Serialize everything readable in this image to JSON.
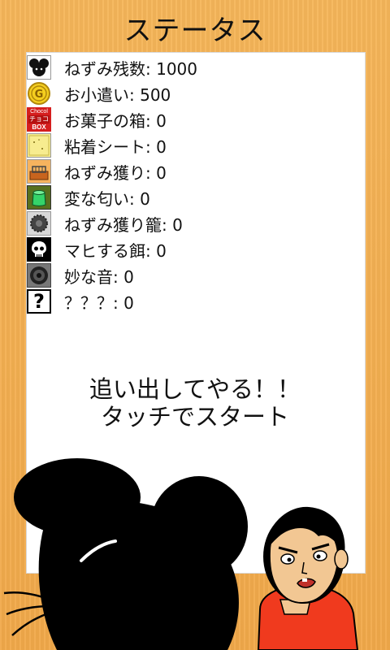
{
  "screen": {
    "title": "ステータス"
  },
  "status_items": [
    {
      "label": "ねずみ残数",
      "value": "1000",
      "icon": "mouse-face-icon"
    },
    {
      "label": "お小遣い",
      "value": "500",
      "icon": "gold-coin-icon"
    },
    {
      "label": "お菓子の箱",
      "value": "0",
      "icon": "choco-box-icon"
    },
    {
      "label": "粘着シート",
      "value": "0",
      "icon": "sticky-sheet-icon"
    },
    {
      "label": "ねずみ獲り",
      "value": "0",
      "icon": "mouse-trap-icon"
    },
    {
      "label": "変な匂い",
      "value": "0",
      "icon": "smell-bottle-icon"
    },
    {
      "label": "ねずみ獲り籠",
      "value": "0",
      "icon": "trap-cage-icon"
    },
    {
      "label": "マヒする餌",
      "value": "0",
      "icon": "skull-icon"
    },
    {
      "label": "妙な音",
      "value": "0",
      "icon": "speaker-icon"
    },
    {
      "label": "？？？",
      "value": "0",
      "icon": "question-icon"
    }
  ],
  "message": {
    "line1": "追い出してやる！！",
    "line2": "タッチでスタート"
  },
  "icon_text": {
    "choco_top": "Chocol",
    "choco_mid": "チョコ",
    "choco_bottom": "BOX"
  },
  "colors": {
    "background": "#f3b04f",
    "panel": "#ffffff",
    "boy_shirt": "#f03a1e"
  }
}
